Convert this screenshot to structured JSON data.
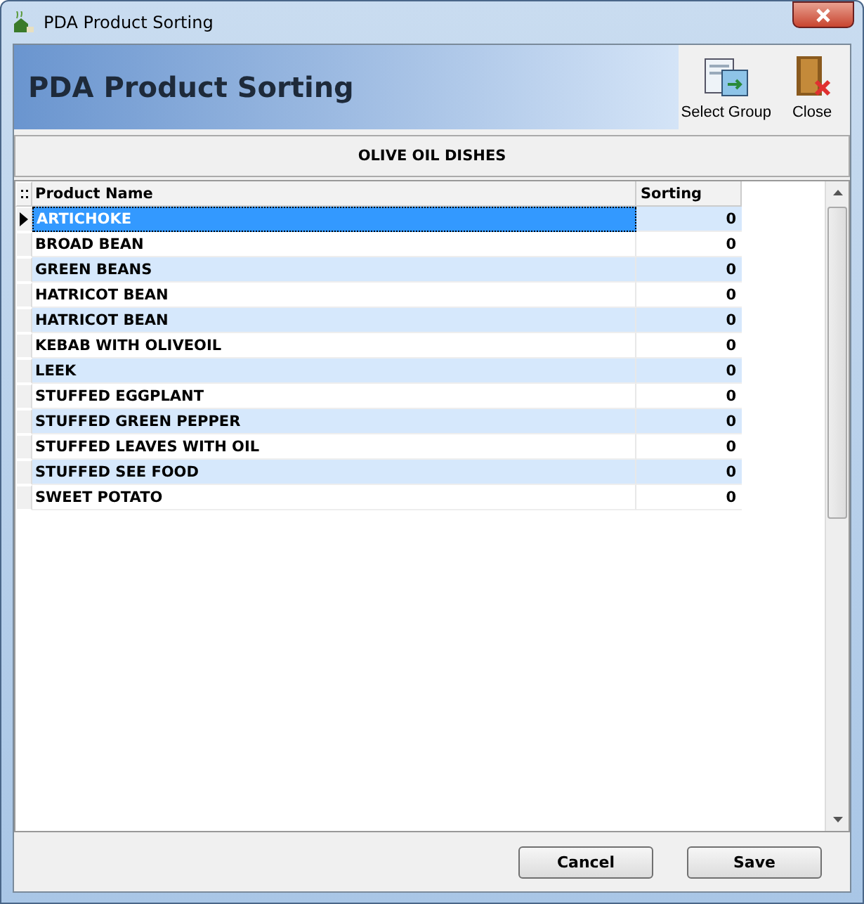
{
  "window": {
    "title": "PDA Product Sorting"
  },
  "header": {
    "title": "PDA Product Sorting",
    "tools": [
      {
        "kind": "group",
        "label": "Select Group"
      },
      {
        "kind": "close",
        "label": "Close"
      }
    ]
  },
  "group": {
    "name": "OLIVE OIL DISHES"
  },
  "table": {
    "columns": [
      "Product Name",
      "Sorting"
    ],
    "rows": [
      {
        "name": "ARTICHOKE",
        "sorting": "0",
        "selected": true
      },
      {
        "name": "BROAD BEAN",
        "sorting": "0",
        "selected": false
      },
      {
        "name": "GREEN BEANS",
        "sorting": "0",
        "selected": false
      },
      {
        "name": "HATRICOT BEAN",
        "sorting": "0",
        "selected": false
      },
      {
        "name": "HATRICOT BEAN",
        "sorting": "0",
        "selected": false
      },
      {
        "name": "KEBAB WITH OLIVEOIL",
        "sorting": "0",
        "selected": false
      },
      {
        "name": "LEEK",
        "sorting": "0",
        "selected": false
      },
      {
        "name": "STUFFED EGGPLANT",
        "sorting": "0",
        "selected": false
      },
      {
        "name": "STUFFED GREEN PEPPER",
        "sorting": "0",
        "selected": false
      },
      {
        "name": "STUFFED LEAVES WITH OIL",
        "sorting": "0",
        "selected": false
      },
      {
        "name": "STUFFED SEE FOOD",
        "sorting": "0",
        "selected": false
      },
      {
        "name": "SWEET POTATO",
        "sorting": "0",
        "selected": false
      }
    ]
  },
  "buttons": [
    "Cancel",
    "Save"
  ]
}
